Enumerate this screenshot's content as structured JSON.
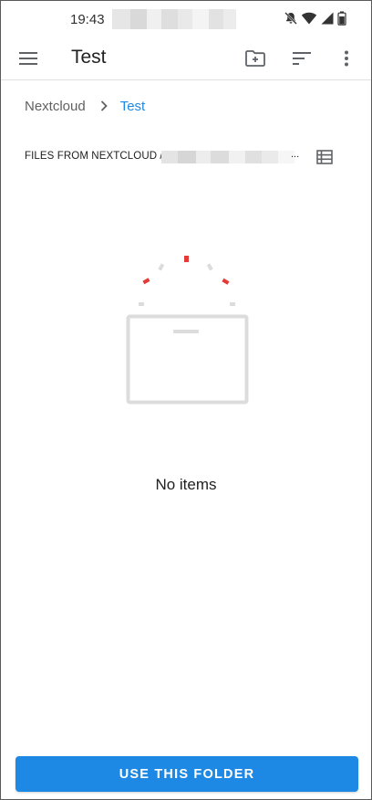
{
  "status_bar": {
    "time": "19:43",
    "icons": [
      "notifications-off-icon",
      "wifi-icon",
      "cell-signal-icon",
      "battery-icon"
    ]
  },
  "toolbar": {
    "title": "Test",
    "icons": [
      "menu-icon",
      "create-folder-icon",
      "sort-icon",
      "more-vert-icon"
    ]
  },
  "breadcrumb": {
    "root": "Nextcloud",
    "separator_icon": "chevron-right-icon",
    "current": "Test"
  },
  "account": {
    "label": "FILES FROM NEXTCLOUD / T",
    "ellipsis": "...",
    "view_toggle_icon": "list-view-icon"
  },
  "empty_state": {
    "illustration_icon": "empty-folder-illustration-icon",
    "text": "No items"
  },
  "bottom_action": {
    "label": "USE THIS FOLDER"
  },
  "colors": {
    "accent": "#1e88e5",
    "text_primary": "#212121",
    "text_secondary": "#616161",
    "illustration_gray": "#dcdcdc",
    "illustration_red": "#e53935"
  }
}
